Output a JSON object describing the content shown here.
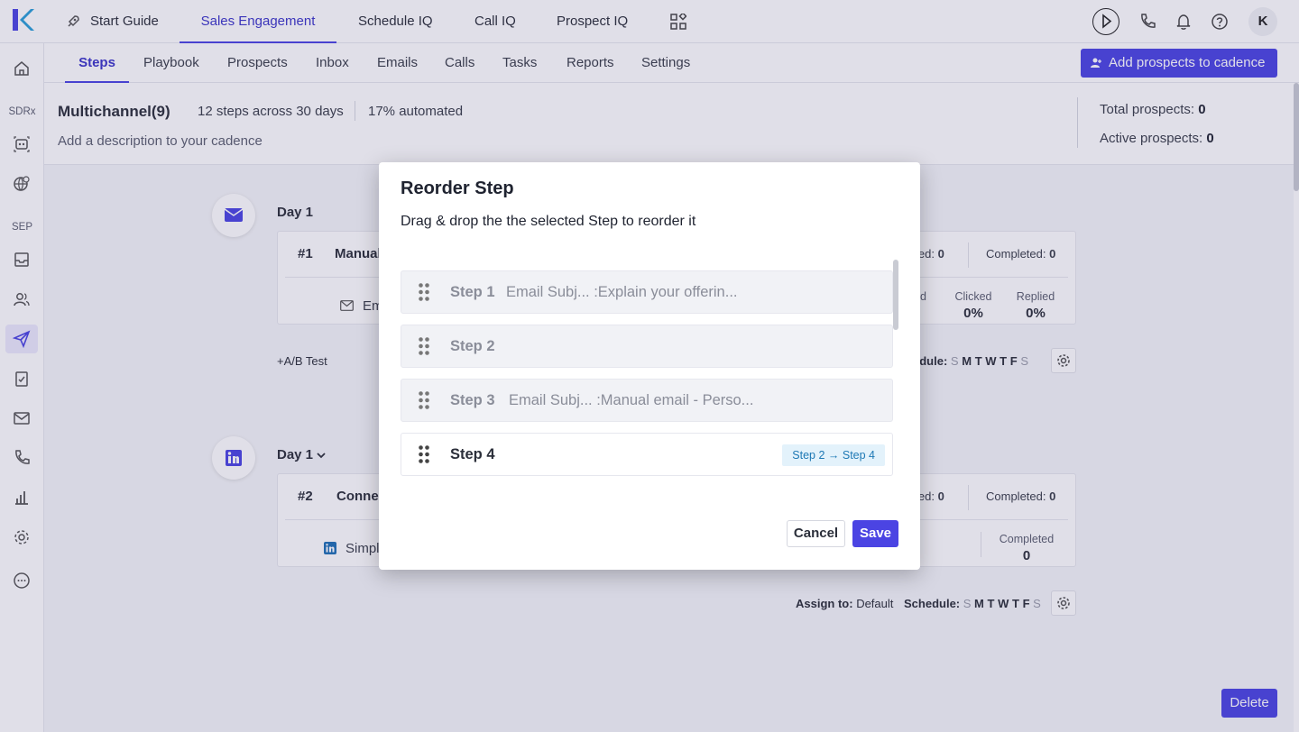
{
  "top_nav": {
    "items": [
      "Start Guide",
      "Sales Engagement",
      "Schedule IQ",
      "Call IQ",
      "Prospect IQ"
    ],
    "active": "Sales Engagement",
    "avatar_initial": "K"
  },
  "sidebar": {
    "section_labels": [
      "SDRx",
      "SEP"
    ]
  },
  "sub_nav": {
    "items": [
      "Steps",
      "Playbook",
      "Prospects",
      "Inbox",
      "Emails",
      "Calls",
      "Tasks",
      "Reports",
      "Settings"
    ],
    "active": "Steps",
    "add_prospects_label": "Add prospects to cadence"
  },
  "cadence": {
    "title": "Multichannel(9)",
    "steps_summary": "12 steps across 30 days",
    "automated": "17% automated",
    "description_placeholder": "Add a description to your cadence",
    "total_prospects_label": "Total prospects:",
    "total_prospects": "0",
    "active_prospects_label": "Active prospects:",
    "active_prospects": "0"
  },
  "steps_background": [
    {
      "day": "Day 1",
      "num": "#1",
      "title": "Manual",
      "sub": "Em",
      "failed_label": "led:",
      "failed": "0",
      "completed_label": "Completed:",
      "completed": "0",
      "metrics": [
        {
          "label": "ed",
          "value": ""
        },
        {
          "label": "Clicked",
          "value": "0%"
        },
        {
          "label": "Replied",
          "value": "0%"
        }
      ],
      "ab_test": "+A/B Test",
      "schedule_label": "edule:"
    },
    {
      "day": "Day 1",
      "num": "#2",
      "title": "Conne",
      "sub": "Simpl",
      "failed_label": "led:",
      "failed": "0",
      "completed_label": "Completed:",
      "completed": "0",
      "completed_block_label": "Completed",
      "completed_block_value": "0",
      "assign_label": "Assign to:",
      "assign_value": "Default",
      "schedule_label": "Schedule:"
    }
  ],
  "schedule_days": [
    "S",
    "M",
    "T",
    "W",
    "T",
    "F",
    "S"
  ],
  "delete_label": "Delete",
  "modal": {
    "title": "Reorder Step",
    "subtitle": "Drag & drop the the selected Step to reorder it",
    "steps": [
      {
        "name": "Step 1",
        "detail": "Email Subj... :Explain your offerin...",
        "selected": false
      },
      {
        "name": "Step 2",
        "detail": "",
        "selected": false
      },
      {
        "name": "Step 3",
        "detail": "Email Subj... :Manual email - Perso...",
        "selected": false
      },
      {
        "name": "Step 4",
        "detail": "",
        "selected": true,
        "badge": "Step 2 → Step 4"
      }
    ],
    "cancel_label": "Cancel",
    "save_label": "Save"
  },
  "colors": {
    "accent": "#4b44e3",
    "badge_bg": "#e3f2fb",
    "badge_text": "#1e79b5"
  }
}
